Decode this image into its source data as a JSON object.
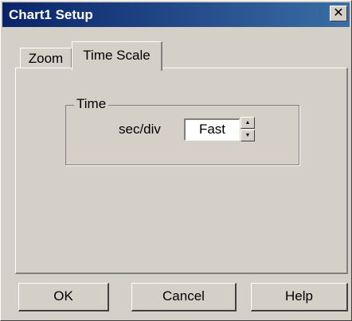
{
  "window": {
    "title": "Chart1 Setup",
    "close_label": "✕"
  },
  "tabs": [
    {
      "label": "Zoom",
      "active": false
    },
    {
      "label": "Time Scale",
      "active": true
    }
  ],
  "time_group": {
    "title": "Time",
    "field_label": "sec/div",
    "value": "Fast",
    "spin_up": "▲",
    "spin_down": "▼"
  },
  "buttons": {
    "ok": "OK",
    "cancel": "Cancel",
    "help": "Help"
  },
  "colors": {
    "titlebar_start": "#0a246a",
    "titlebar_end": "#3a6ea5",
    "face": "#d4d0c8"
  }
}
